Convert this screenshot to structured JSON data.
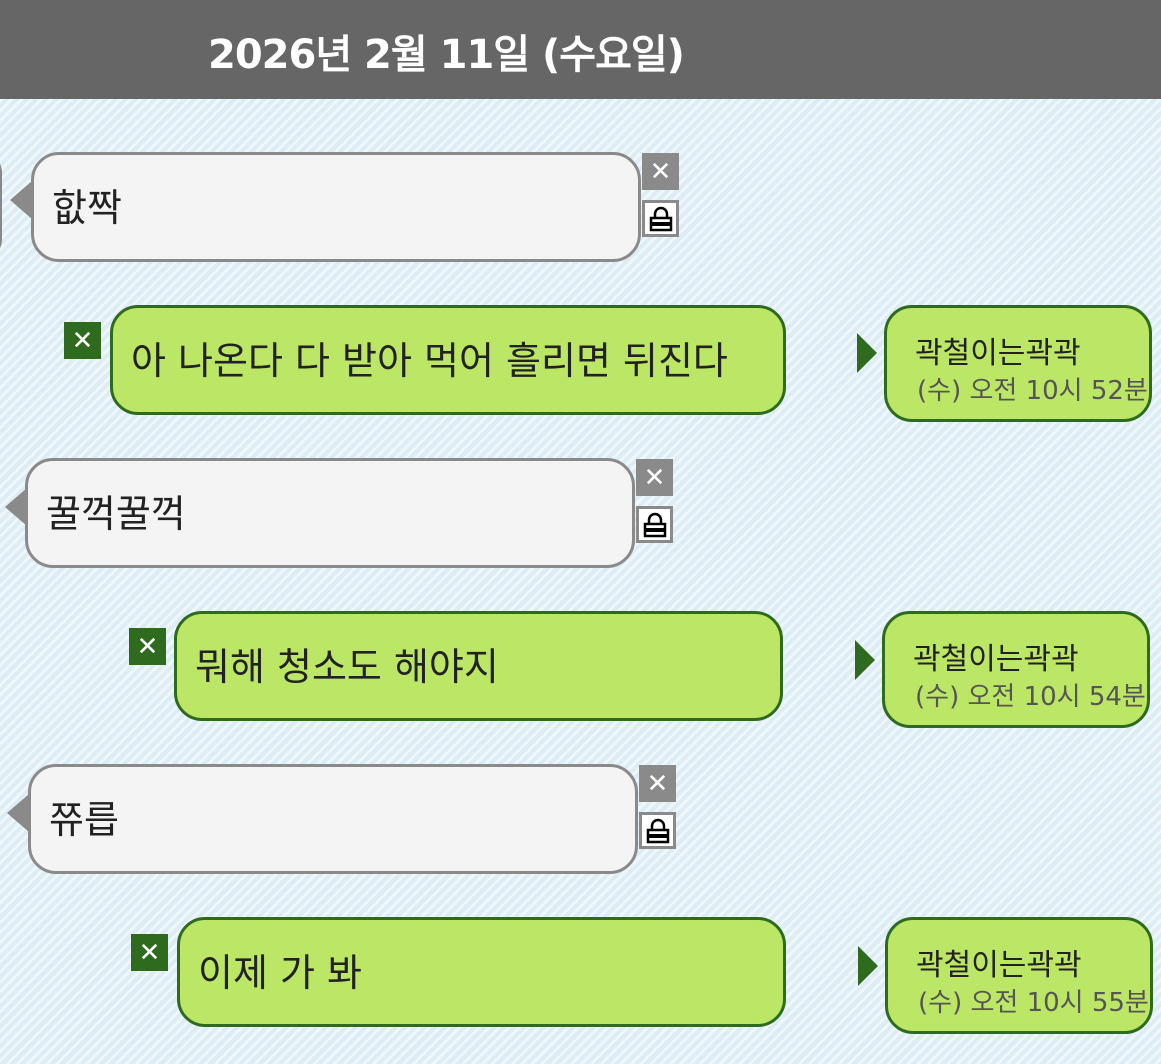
{
  "header": {
    "date": "2026년 2월 11일 (수요일)"
  },
  "colors": {
    "header_bg": "#666666",
    "incoming_bubble": "#f4f4f4",
    "outgoing_bubble": "#bce665",
    "outgoing_border": "#2e6b1e",
    "background": "#dcedf6"
  },
  "icons": {
    "delete_gray": "close-icon",
    "lock": "lock-icon",
    "delete_green": "close-icon"
  },
  "messages": [
    {
      "direction": "incoming",
      "text": "핪짝"
    },
    {
      "direction": "outgoing",
      "text": "아 나온다 다 받아 먹어 흘리면 뒤진다",
      "sender": "곽철이는곽곽",
      "time": "(수) 오전 10시 52분"
    },
    {
      "direction": "incoming",
      "text": "꿀꺽꿀꺽"
    },
    {
      "direction": "outgoing",
      "text": "뭐해 청소도 해야지",
      "sender": "곽철이는곽곽",
      "time": "(수) 오전 10시 54분"
    },
    {
      "direction": "incoming",
      "text": "쮸릅"
    },
    {
      "direction": "outgoing",
      "text": "이제 가 봐",
      "sender": "곽철이는곽곽",
      "time": "(수) 오전 10시 55분"
    }
  ]
}
